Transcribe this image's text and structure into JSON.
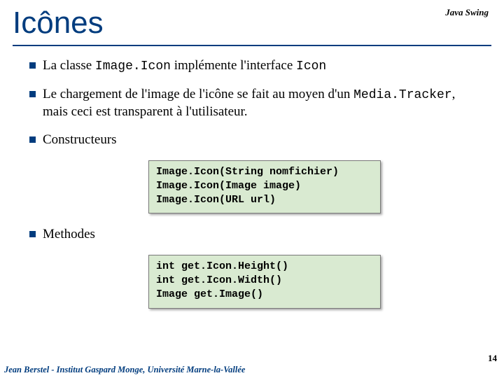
{
  "header": {
    "label": "Java Swing"
  },
  "title": "Icônes",
  "bullets": {
    "b1_pre": "La classe ",
    "b1_code1": "Image.Icon",
    "b1_mid": " implémente l'interface ",
    "b1_code2": "Icon",
    "b2_pre": "Le chargement de l'image de l'icône se fait au moyen d'un ",
    "b2_code": "Media.Tracker",
    "b2_post": ", mais ceci est transparent à l'utilisateur.",
    "b3": "Constructeurs",
    "b4": "Methodes"
  },
  "code1": "Image.Icon(String nomfichier)\nImage.Icon(Image image)\nImage.Icon(URL url)",
  "code2": "int get.Icon.Height()\nint get.Icon.Width()\nImage get.Image()",
  "footer": "Jean Berstel  -   Institut Gaspard Monge, Université Marne-la-Vallée",
  "page": "14"
}
